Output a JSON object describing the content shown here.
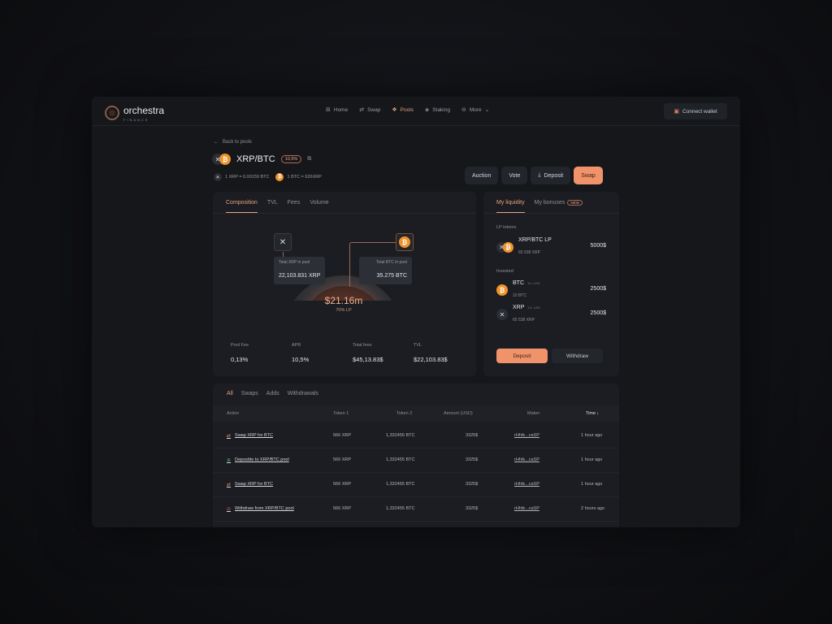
{
  "brand": {
    "name": "orchestra",
    "sub": "FINANCE"
  },
  "nav": {
    "items": [
      {
        "label": "Home",
        "icon": "grid-icon",
        "glyph": "⊞",
        "active": false
      },
      {
        "label": "Swap",
        "icon": "swap-icon",
        "glyph": "⇄",
        "active": false
      },
      {
        "label": "Pools",
        "icon": "pools-icon",
        "glyph": "❖",
        "active": true
      },
      {
        "label": "Staking",
        "icon": "staking-icon",
        "glyph": "◈",
        "active": false
      },
      {
        "label": "More",
        "icon": "more-icon",
        "glyph": "⊖",
        "active": false
      }
    ],
    "connect_label": "Connect wallet"
  },
  "header": {
    "back_label": "Back to pools",
    "pair_name": "XRP/BTC",
    "pct_badge": "10,5%",
    "rate_xrp": "1 XRP = 0.00159 BTC",
    "rate_btc": "1 BTC = 626XRP"
  },
  "actions": {
    "auction": "Auction",
    "vote": "Vote",
    "deposit": "Deposit",
    "swap": "Swap"
  },
  "composition": {
    "tabs": [
      "Composition",
      "TVL",
      "Fees",
      "Volume"
    ],
    "total_value": "$21.16m",
    "lp_share": "70% LP",
    "xrp_label": "Total XRP in pool",
    "xrp_value": "22,103.831 XRP",
    "btc_label": "Total BTC in pool",
    "btc_value": "35.275 BTC",
    "stats": [
      {
        "label": "Pool Fee",
        "value": "0,13%"
      },
      {
        "label": "APR",
        "value": "10,5%"
      },
      {
        "label": "Total fees",
        "value": "$45,13.83$"
      },
      {
        "label": "TVL",
        "value": "$22,103.83$"
      }
    ]
  },
  "liquidity": {
    "tabs": [
      "My liquidity",
      "My bonuses"
    ],
    "new_badge": "NEW",
    "lp_section": "LP tokens",
    "lp": {
      "name": "XRP/BTC LP",
      "sub": "65 538 XRP",
      "amount": "5000$"
    },
    "invested_section": "Invested",
    "invested": [
      {
        "name": "BTC",
        "tag": "1H, USD",
        "sub": "10 BTC",
        "amount": "2500$"
      },
      {
        "name": "XRP",
        "tag": "1H, USD",
        "sub": "65 538 XRP",
        "amount": "2500$"
      }
    ],
    "deposit": "Deposit",
    "withdraw": "Withdraw"
  },
  "activity": {
    "tabs": [
      "All",
      "Swaps",
      "Adds",
      "Withdrawals"
    ],
    "columns": {
      "action": "Action",
      "token1": "Token 1",
      "token2": "Token 2",
      "amount": "Amount (USD)",
      "maker": "Maker",
      "time": "Time ↓"
    },
    "rows": [
      {
        "type": "swap",
        "action": "Swap XRP for BTC",
        "token1": "566 XRP",
        "token2": "1,332455 BTC",
        "amount": "3325$",
        "maker": "rHhtk...caSP",
        "time": "1 hour ago"
      },
      {
        "type": "dep",
        "action": "Depostite to XRP/BTC pool",
        "token1": "566 XRP",
        "token2": "1,332455 BTC",
        "amount": "3325$",
        "maker": "rHhtk...caSP",
        "time": "1 hour ago"
      },
      {
        "type": "swap",
        "action": "Swap XRP for BTC",
        "token1": "566 XRP",
        "token2": "1,332455 BTC",
        "amount": "3325$",
        "maker": "rHhtk...caSP",
        "time": "1 hour ago"
      },
      {
        "type": "wd",
        "action": "Withdraw from XRP/BTC pool",
        "token1": "566 XRP",
        "token2": "1,332455 BTC",
        "amount": "3325$",
        "maker": "rHhtk...caSP",
        "time": "2 hours ago"
      }
    ]
  },
  "colors": {
    "accent": "#f0936b",
    "background": "#15171b",
    "panel": "#1b1d22",
    "btc": "#f0932b"
  }
}
